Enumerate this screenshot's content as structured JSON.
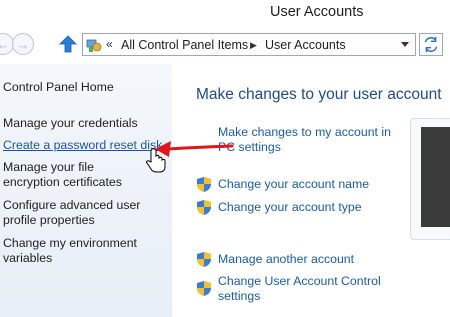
{
  "window": {
    "title": "User Accounts"
  },
  "navbar": {
    "back_glyph": "←",
    "forward_glyph": "→",
    "chevron": "«",
    "crumbs": [
      "All Control Panel Items",
      "User Accounts"
    ],
    "separator": "▶"
  },
  "sidebar": {
    "home": "Control Panel Home",
    "items": [
      "Manage your credentials",
      "Create a password reset disk",
      "Manage your file encryption certificates",
      "Configure advanced user profile properties",
      "Change my environment variables"
    ]
  },
  "main": {
    "title": "Make changes to your user account",
    "links": [
      "Make changes to my account in PC settings",
      "Change your account name",
      "Change your account type",
      "Manage another account",
      "Change User Account Control settings"
    ]
  },
  "colors": {
    "link": "#1a5ba8",
    "title": "#1f4a8c",
    "arrow": "#e0161c",
    "sidebar_bg": "#eef3f9"
  },
  "icons": [
    "back-icon",
    "forward-icon",
    "up-arrow-icon",
    "control-panel-icon",
    "refresh-icon",
    "shield-icon",
    "hand-cursor-icon"
  ]
}
